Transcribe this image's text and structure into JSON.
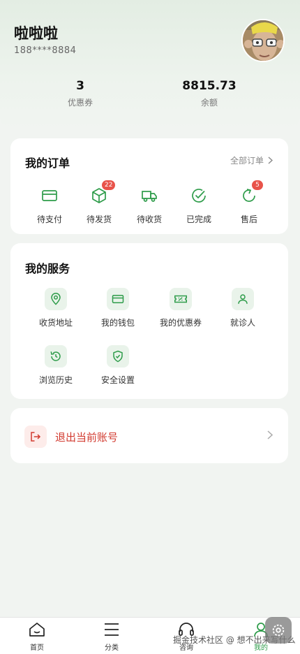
{
  "profile": {
    "name": "啦啦啦",
    "phone": "188****8884",
    "stats": [
      {
        "value": "3",
        "label": "优惠券"
      },
      {
        "value": "8815.73",
        "label": "余额"
      }
    ]
  },
  "orders": {
    "title": "我的订单",
    "all_label": "全部订单",
    "items": [
      {
        "label": "待支付",
        "icon": "card-icon"
      },
      {
        "label": "待发货",
        "icon": "box-icon",
        "badge": "22"
      },
      {
        "label": "待收货",
        "icon": "truck-icon"
      },
      {
        "label": "已完成",
        "icon": "check-circle-icon"
      },
      {
        "label": "售后",
        "icon": "refresh-icon",
        "badge": "5"
      }
    ]
  },
  "services": {
    "title": "我的服务",
    "items": [
      {
        "label": "收货地址",
        "icon": "location-icon"
      },
      {
        "label": "我的钱包",
        "icon": "wallet-icon"
      },
      {
        "label": "我的优惠券",
        "icon": "coupon-icon"
      },
      {
        "label": "就诊人",
        "icon": "person-icon"
      },
      {
        "label": "浏览历史",
        "icon": "history-icon"
      },
      {
        "label": "安全设置",
        "icon": "shield-icon"
      }
    ]
  },
  "logout": {
    "label": "退出当前账号"
  },
  "tabbar": {
    "tabs": [
      {
        "label": "首页",
        "icon": "home-icon"
      },
      {
        "label": "分类",
        "icon": "menu-icon"
      },
      {
        "label": "咨询",
        "icon": "headset-icon"
      },
      {
        "label": "我的",
        "icon": "user-icon",
        "active": true
      }
    ]
  },
  "watermark": "掘金技术社区 @ 想不出来写什么",
  "colors": {
    "accent": "#2e9c4a",
    "danger": "#d23a2f",
    "badge": "#e8534a"
  }
}
